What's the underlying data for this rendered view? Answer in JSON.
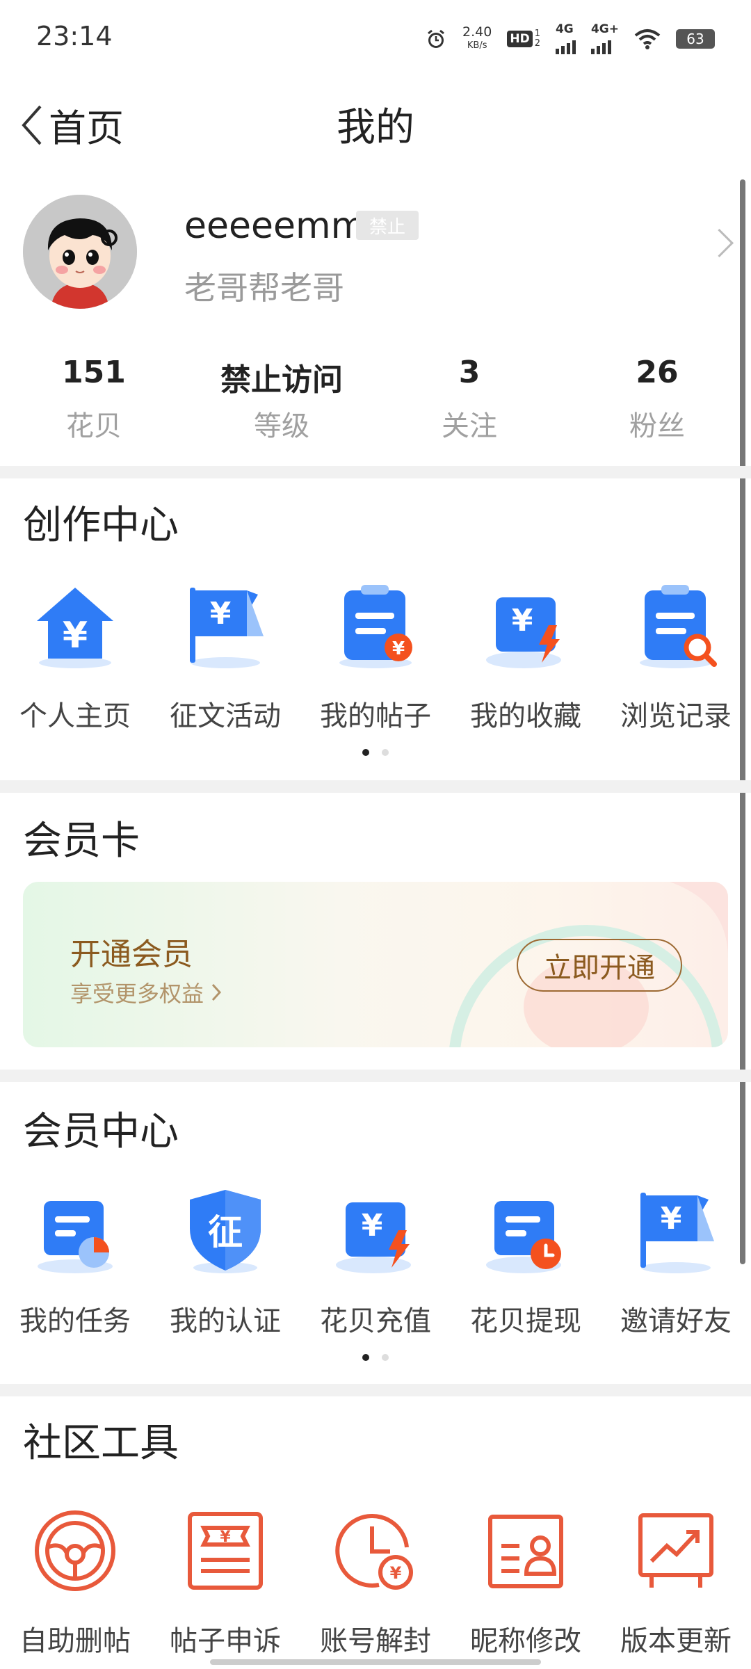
{
  "status_bar": {
    "time": "23:14",
    "net_speed_value": "2.40",
    "net_speed_unit": "KB/s",
    "hd_label": "HD",
    "hd_sub_top": "1",
    "hd_sub_bottom": "2",
    "sim1_label": "4G",
    "sim2_label": "4G+",
    "battery": "63",
    "icons": [
      "alarm-icon",
      "hd-icon",
      "signal-icon",
      "signal-icon",
      "wifi-icon",
      "battery-icon"
    ]
  },
  "nav": {
    "back_label": "首页",
    "title": "我的"
  },
  "profile": {
    "username": "eeeeemm",
    "badge": "禁止",
    "signature": "老哥帮老哥",
    "stats": [
      {
        "value": "151",
        "label": "花贝"
      },
      {
        "value": "禁止访问",
        "label": "等级"
      },
      {
        "value": "3",
        "label": "关注"
      },
      {
        "value": "26",
        "label": "粉丝"
      }
    ]
  },
  "creation_center": {
    "title": "创作中心",
    "items": [
      {
        "label": "个人主页",
        "icon": "home-yen-icon"
      },
      {
        "label": "征文活动",
        "icon": "flag-yen-icon"
      },
      {
        "label": "我的帖子",
        "icon": "post-clipboard-icon"
      },
      {
        "label": "我的收藏",
        "icon": "collection-yen-icon"
      },
      {
        "label": "浏览记录",
        "icon": "history-search-icon"
      }
    ]
  },
  "member_card": {
    "title": "会员卡",
    "card_title": "开通会员",
    "card_subtitle": "享受更多权益",
    "button": "立即开通"
  },
  "member_center": {
    "title": "会员中心",
    "items": [
      {
        "label": "我的任务",
        "icon": "task-icon"
      },
      {
        "label": "我的认证",
        "icon": "certification-shield-icon"
      },
      {
        "label": "花贝充值",
        "icon": "recharge-yen-icon"
      },
      {
        "label": "花贝提现",
        "icon": "withdraw-clock-icon"
      },
      {
        "label": "邀请好友",
        "icon": "invite-flag-icon"
      }
    ],
    "shield_char": "征"
  },
  "community_tools": {
    "title": "社区工具",
    "items": [
      {
        "label": "自助删帖",
        "icon": "steering-wheel-icon"
      },
      {
        "label": "帖子申诉",
        "icon": "appeal-ticket-icon"
      },
      {
        "label": "账号解封",
        "icon": "unlock-clock-icon"
      },
      {
        "label": "昵称修改",
        "icon": "nickname-card-icon"
      },
      {
        "label": "版本更新",
        "icon": "update-chart-icon"
      }
    ]
  },
  "carousel": {
    "pages": 2,
    "active": 1
  },
  "colors": {
    "icon_blue": "#2f7cf6",
    "icon_light_blue": "#d9e8fd",
    "icon_orange": "#f4511e",
    "tool_red": "#e8593b",
    "vip_brown": "#8b5a1f"
  }
}
